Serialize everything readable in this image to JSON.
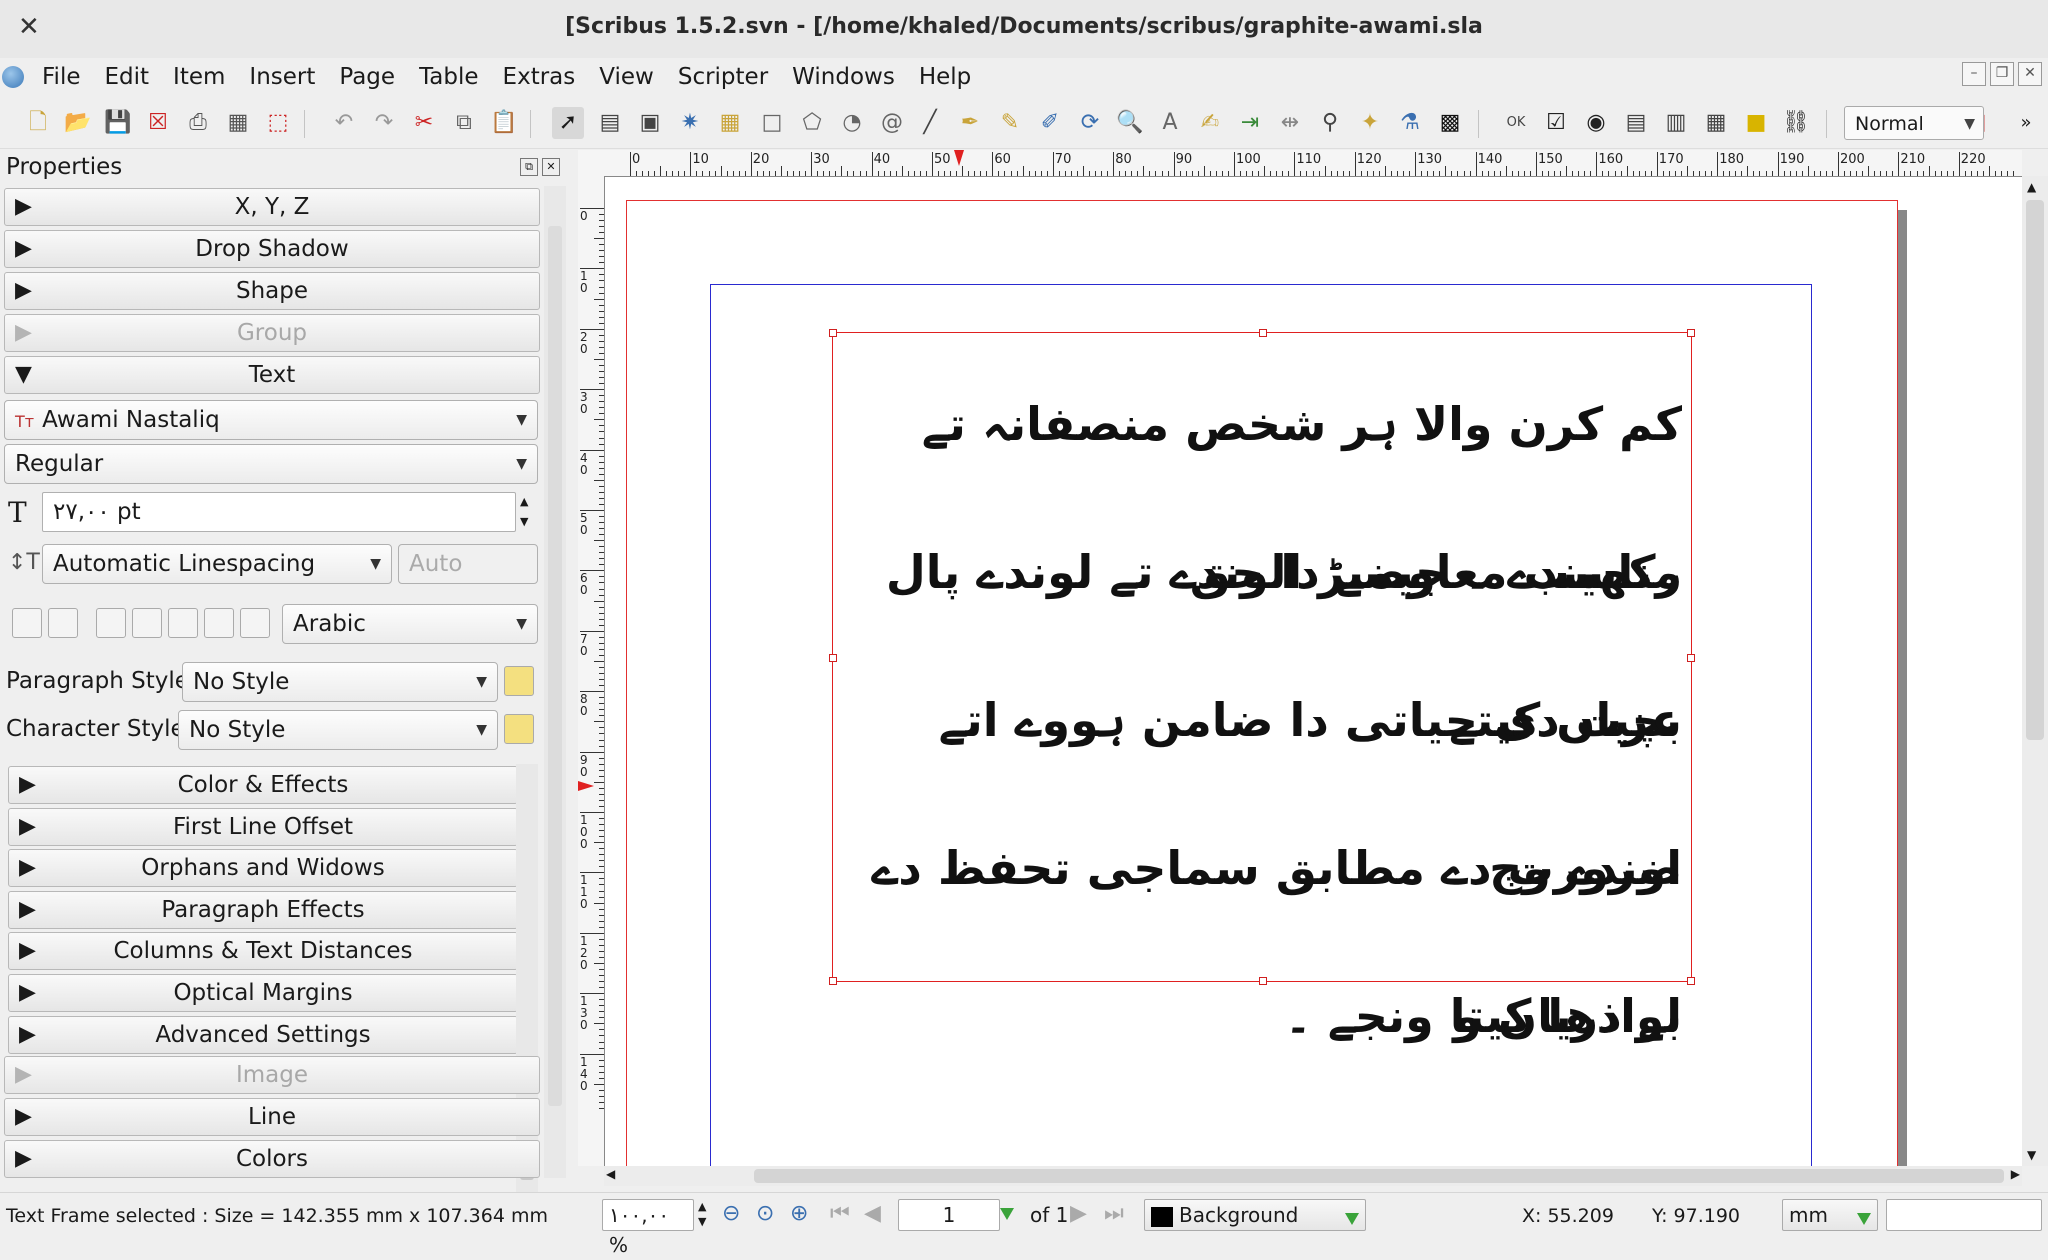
{
  "window": {
    "title": "[Scribus 1.5.2.svn - [/home/khaled/Documents/scribus/graphite-awami.sla"
  },
  "menu": [
    "File",
    "Edit",
    "Item",
    "Insert",
    "Page",
    "Table",
    "Extras",
    "View",
    "Scripter",
    "Windows",
    "Help"
  ],
  "toolbar": {
    "mode": "Normal"
  },
  "properties": {
    "title": "Properties",
    "sections_top": [
      {
        "label": "X, Y, Z",
        "enabled": true,
        "expanded": false
      },
      {
        "label": "Drop Shadow",
        "enabled": true,
        "expanded": false
      },
      {
        "label": "Shape",
        "enabled": true,
        "expanded": false
      },
      {
        "label": "Group",
        "enabled": false,
        "expanded": false
      },
      {
        "label": "Text",
        "enabled": true,
        "expanded": true
      }
    ],
    "font_family": "Awami Nastaliq",
    "font_style": "Regular",
    "font_size": "۲۷,۰۰ pt",
    "linespacing_mode": "Automatic Linespacing",
    "linespacing_value": "Auto",
    "language": "Arabic",
    "paragraph_style_label": "Paragraph Style:",
    "paragraph_style": "No Style",
    "character_style_label": "Character Style:",
    "character_style": "No Style",
    "text_subsections": [
      "Color & Effects",
      "First Line Offset",
      "Orphans and Widows",
      "Paragraph Effects",
      "Columns & Text Distances",
      "Optical Margins",
      "Advanced Settings"
    ],
    "sections_bottom": [
      {
        "label": "Image",
        "enabled": false
      },
      {
        "label": "Line",
        "enabled": true
      },
      {
        "label": "Colors",
        "enabled": true
      }
    ]
  },
  "ruler": {
    "h_labels": [
      "0",
      "10",
      "20",
      "30",
      "40",
      "50",
      "60",
      "70",
      "80",
      "90",
      "100",
      "110",
      "120",
      "130",
      "140",
      "150",
      "160",
      "170",
      "180",
      "190",
      "200",
      "210",
      "220"
    ],
    "v_labels": [
      "0",
      "10",
      "20",
      "30",
      "40",
      "50",
      "60",
      "70",
      "80",
      "90",
      "100",
      "110",
      "120",
      "130",
      "140"
    ]
  },
  "document": {
    "lines": [
      "کم کرن والا ہر شخص منصفانہ تے مناسب معاوضے دا حق",
      "رکھیندے ۔ جیمبڑ الوندے تے لوندے پال بچیاں کیتے",
      "عزت دی حیاتی دا ضامن ہووے اتے اوندے وچ",
      "ضرورت دے مطابق سماجی تحفظ دے بے ذریاں و",
      "لوادھا کیتا ونجے ۔"
    ]
  },
  "status": {
    "message": "Text Frame selected : Size = 142.355 mm x 107.364 mm",
    "zoom": "۱۰۰,۰۰ %",
    "page": "1",
    "page_of": "of 1",
    "layer": "Background",
    "x": "X:  55.209",
    "y": "Y:  97.190",
    "unit": "mm"
  },
  "colors": {
    "frame_border": "#e02020",
    "margin_guides": "#2a2ad0"
  }
}
